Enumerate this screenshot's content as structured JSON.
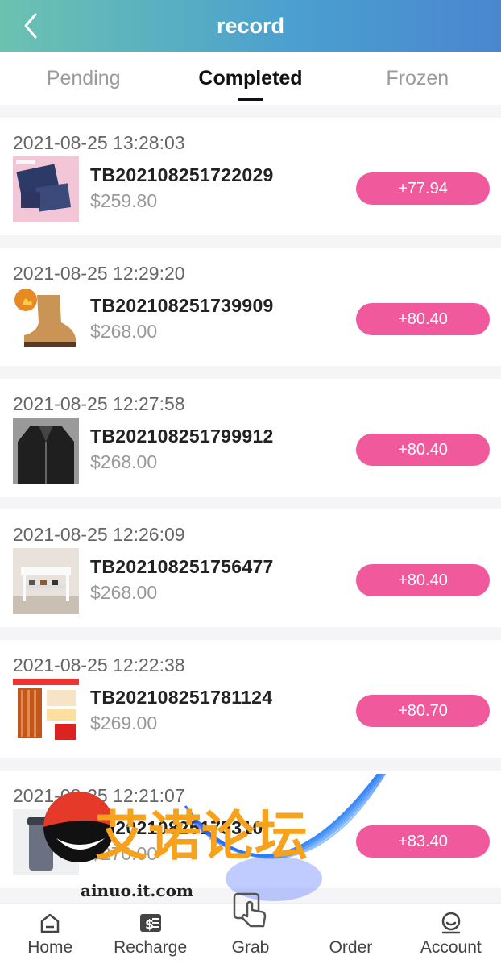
{
  "header": {
    "title": "record"
  },
  "tabs": [
    {
      "label": "Pending",
      "active": false
    },
    {
      "label": "Completed",
      "active": true
    },
    {
      "label": "Frozen",
      "active": false
    }
  ],
  "records": [
    {
      "time": "2021-08-25 13:28:03",
      "order_no": "TB202108251722029",
      "price": "$259.80",
      "commission": "+77.94",
      "thumb": "product-mats"
    },
    {
      "time": "2021-08-25 12:29:20",
      "order_no": "TB202108251739909",
      "price": "$268.00",
      "commission": "+80.40",
      "thumb": "leather-boot"
    },
    {
      "time": "2021-08-25 12:27:58",
      "order_no": "TB202108251799912",
      "price": "$268.00",
      "commission": "+80.40",
      "thumb": "leather-jacket"
    },
    {
      "time": "2021-08-25 12:26:09",
      "order_no": "TB202108251756477",
      "price": "$268.00",
      "commission": "+80.40",
      "thumb": "shoe-bench"
    },
    {
      "time": "2021-08-25 12:22:38",
      "order_no": "TB202108251781124",
      "price": "$269.00",
      "commission": "+80.70",
      "thumb": "oil-heater"
    },
    {
      "time": "2021-08-25 12:21:07",
      "order_no": "TB20210825175310",
      "price": "$270.00",
      "commission": "+83.40",
      "thumb": "tumbler"
    }
  ],
  "bottom_nav": [
    {
      "label": "Home",
      "icon": "home-icon"
    },
    {
      "label": "Recharge",
      "icon": "recharge-icon"
    },
    {
      "label": "Grab",
      "icon": "hand-pointer-icon"
    },
    {
      "label": "Order",
      "icon": "order-icon"
    },
    {
      "label": "Account",
      "icon": "account-icon"
    }
  ],
  "watermark": {
    "text": "艾诺论坛",
    "url": "ainuo.it.com"
  },
  "colors": {
    "accent_pink": "#f05a9c",
    "header_start": "#6cc2b0",
    "header_end": "#4a86cf"
  }
}
